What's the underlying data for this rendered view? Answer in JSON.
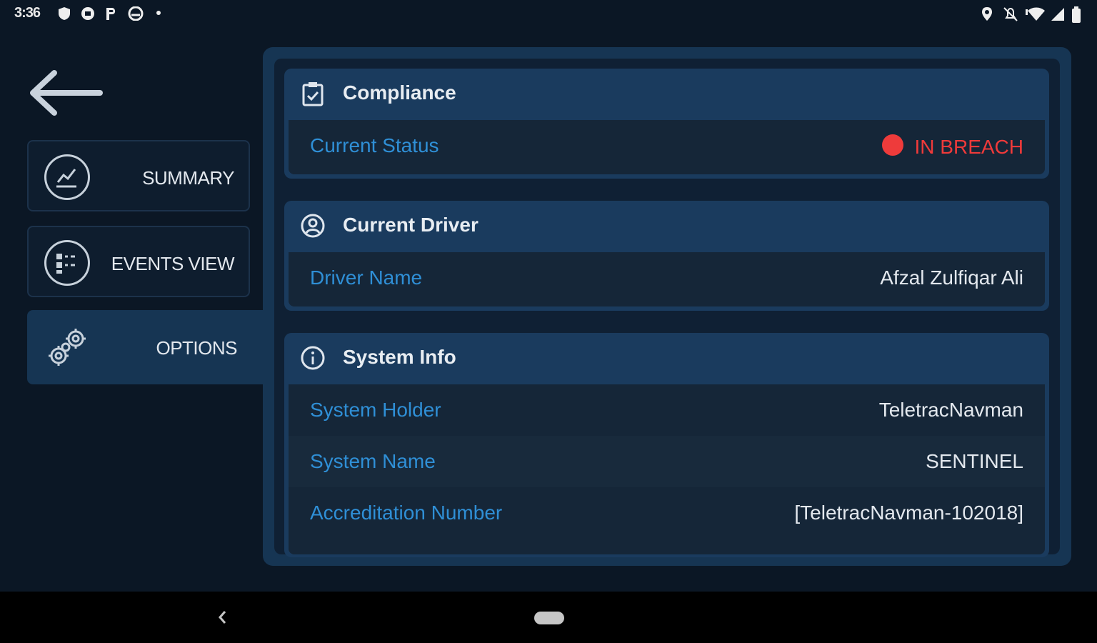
{
  "status_bar": {
    "time": "3:36",
    "left_icons": [
      "notification-shield-icon",
      "notification-circle-icon",
      "parking-icon",
      "cloud-icon",
      "dot-icon"
    ],
    "right_icons": [
      "location-icon",
      "bell-off-icon",
      "wifi-icon",
      "signal-icon",
      "battery-icon"
    ]
  },
  "sidebar": {
    "back_icon": "arrow-left-icon",
    "items": [
      {
        "label": "SUMMARY",
        "icon": "chart-trend-icon",
        "active": false
      },
      {
        "label": "EVENTS VIEW",
        "icon": "list-icon",
        "active": false
      },
      {
        "label": "OPTIONS",
        "icon": "gears-icon",
        "active": true
      }
    ]
  },
  "compliance": {
    "title": "Compliance",
    "icon": "clipboard-check-icon",
    "rows": [
      {
        "key": "Current Status",
        "value": "IN BREACH",
        "status_color": "#ee3b3b"
      }
    ]
  },
  "driver": {
    "title": "Current Driver",
    "icon": "user-circle-icon",
    "rows": [
      {
        "key": "Driver Name",
        "value": "Afzal Zulfiqar Ali"
      }
    ]
  },
  "system": {
    "title": "System Info",
    "icon": "info-icon",
    "rows": [
      {
        "key": "System Holder",
        "value": "TeletracNavman"
      },
      {
        "key": "System Name",
        "value": "SENTINEL"
      },
      {
        "key": "Accreditation Number",
        "value": "[TeletracNavman-102018]"
      }
    ]
  },
  "colors": {
    "background": "#0b1725",
    "panel": "#163553",
    "card_header": "#1a3b5e",
    "key_text": "#2f8fd6",
    "breach": "#ee3b3b"
  },
  "nav_bar": {
    "back_icon": "chevron-left-icon",
    "home_icon": "home-pill-icon"
  }
}
